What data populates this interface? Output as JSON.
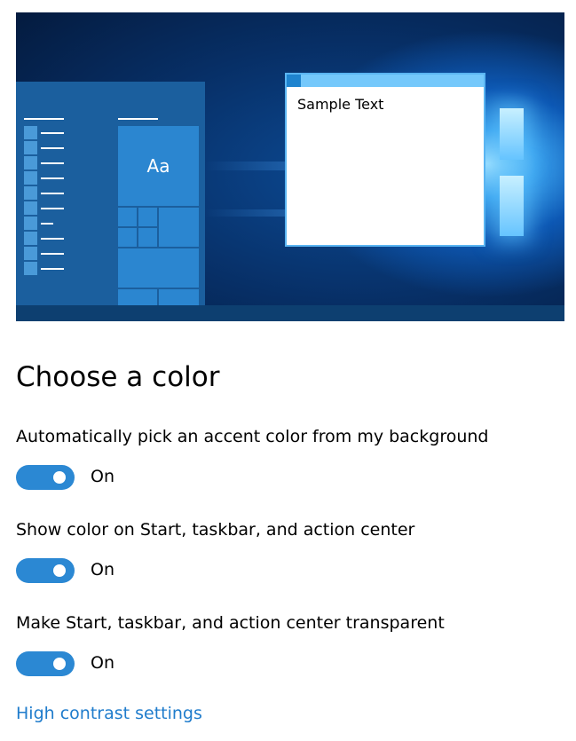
{
  "preview": {
    "sample_text": "Sample Text",
    "tile_label": "Aa"
  },
  "heading": "Choose a color",
  "settings": [
    {
      "label": "Automatically pick an accent color from my background",
      "state": "On",
      "enabled": true
    },
    {
      "label": "Show color on Start, taskbar, and action center",
      "state": "On",
      "enabled": true
    },
    {
      "label": "Make Start, taskbar, and action center transparent",
      "state": "On",
      "enabled": true
    }
  ],
  "link": {
    "label": "High contrast settings"
  },
  "colors": {
    "accent": "#2b88d3",
    "link": "#1f7ccc",
    "start_panel": "#1b5f9e",
    "tile": "#2b86d0"
  }
}
